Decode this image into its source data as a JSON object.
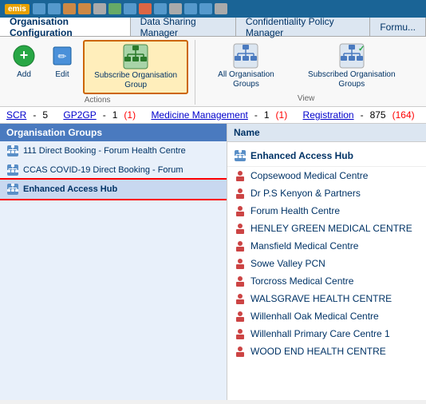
{
  "titleBar": {
    "logo": "emis",
    "icons": [
      "icon1",
      "icon2",
      "icon3",
      "icon4",
      "icon5",
      "icon6",
      "icon7",
      "icon8",
      "icon9",
      "icon10",
      "icon11",
      "icon12",
      "icon13"
    ]
  },
  "tabs": [
    {
      "label": "Organisation Configuration",
      "active": true
    },
    {
      "label": "Data Sharing Manager",
      "active": false
    },
    {
      "label": "Confidentiality Policy Manager",
      "active": false
    },
    {
      "label": "Formu...",
      "active": false
    }
  ],
  "ribbon": {
    "actions": {
      "label": "Actions",
      "buttons": [
        {
          "id": "add",
          "label": "Add",
          "icon": "add"
        },
        {
          "id": "edit",
          "label": "Edit",
          "icon": "edit"
        },
        {
          "id": "subscribe",
          "label": "Subscribe Organisation Group",
          "icon": "subscribe",
          "active": true
        }
      ]
    },
    "view": {
      "label": "View",
      "buttons": [
        {
          "id": "all-groups",
          "label": "All Organisation Groups",
          "icon": "all-groups"
        },
        {
          "id": "subscribed-groups",
          "label": "Subscribed Organisation Groups",
          "icon": "subscribed-groups"
        }
      ]
    }
  },
  "navBar": [
    {
      "label": "SCR",
      "sep": "-",
      "num": "5",
      "link": true
    },
    {
      "label": "GP2GP",
      "sep": "-",
      "num": "1",
      "count": "(1)",
      "link": true
    },
    {
      "label": "Medicine Management",
      "sep": "-",
      "num": "1",
      "count": "(1)",
      "link": true
    },
    {
      "label": "Registration",
      "sep": "-",
      "num": "875",
      "count": "(164)",
      "link": true
    }
  ],
  "leftPanel": {
    "title": "Organisation Groups",
    "items": [
      {
        "label": "111 Direct Booking - Forum Health Centre",
        "selected": false
      },
      {
        "label": "CCAS COVID-19 Direct Booking - Forum",
        "selected": false
      },
      {
        "label": "Enhanced Access Hub",
        "selected": true
      }
    ]
  },
  "rightPanel": {
    "header": "Name",
    "headerItem": "Enhanced Access Hub",
    "items": [
      {
        "label": "Copsewood Medical Centre"
      },
      {
        "label": "Dr P.S Kenyon & Partners"
      },
      {
        "label": "Forum Health Centre"
      },
      {
        "label": "HENLEY GREEN MEDICAL CENTRE"
      },
      {
        "label": "Mansfield Medical Centre"
      },
      {
        "label": "Sowe Valley PCN"
      },
      {
        "label": "Torcross Medical Centre"
      },
      {
        "label": "WALSGRAVE HEALTH CENTRE"
      },
      {
        "label": "Willenhall Oak Medical Centre"
      },
      {
        "label": "Willenhall Primary Care Centre 1"
      },
      {
        "label": "WOOD END HEALTH CENTRE"
      }
    ]
  }
}
